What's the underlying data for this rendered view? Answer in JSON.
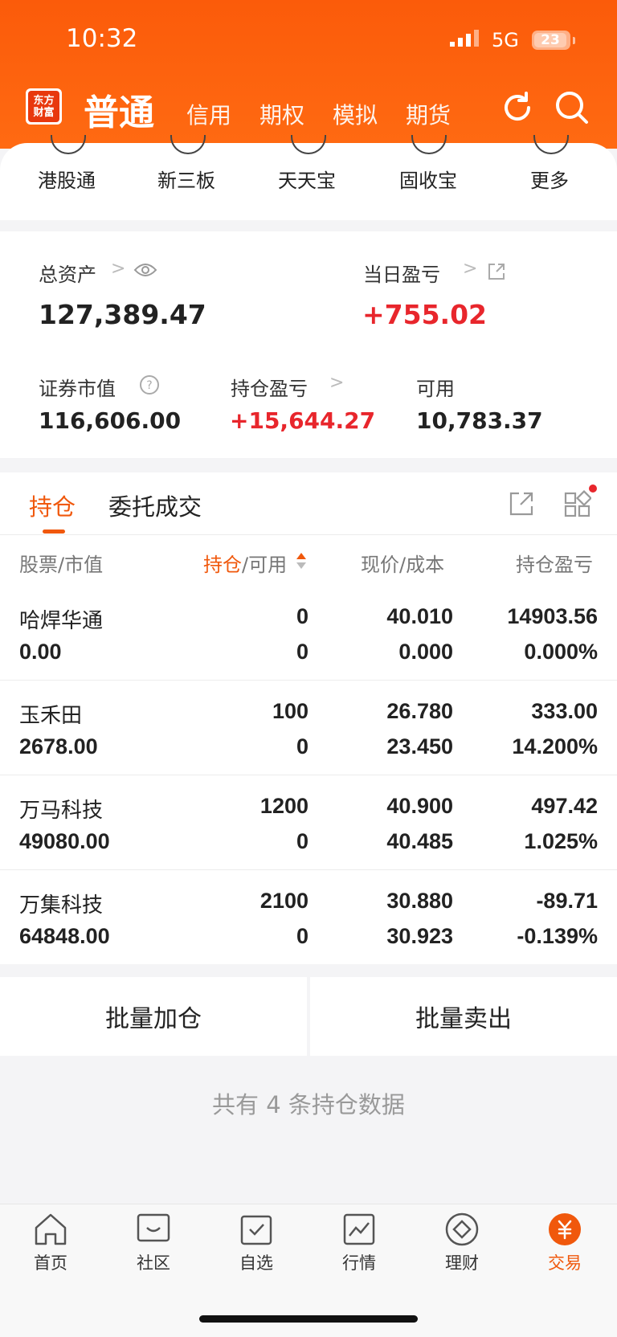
{
  "status_bar": {
    "time": "10:32",
    "network": "5G",
    "battery": "23"
  },
  "header": {
    "logo_line1": "东方",
    "logo_line2": "财富",
    "active_tab": "普通",
    "tabs": [
      "信用",
      "期权",
      "模拟",
      "期货"
    ]
  },
  "quick_menu": [
    "港股通",
    "新三板",
    "天天宝",
    "固收宝",
    "更多"
  ],
  "assets": {
    "total_label": "总资产",
    "total_value": "127,389.47",
    "daily_pl_label": "当日盈亏",
    "daily_pl_value": "+755.02",
    "market_value_label": "证券市值",
    "market_value": "116,606.00",
    "position_pl_label": "持仓盈亏",
    "position_pl_value": "+15,644.27",
    "available_label": "可用",
    "available_value": "10,783.37"
  },
  "positions": {
    "tab_active": "持仓",
    "tab_other": "委托成交",
    "headers": {
      "stock": "股票",
      "market_value": "市值",
      "hold": "持仓",
      "available": "可用",
      "price": "现价",
      "cost": "成本",
      "pl": "持仓盈亏"
    },
    "rows": [
      {
        "name": "哈焊华通",
        "market_value": "0.00",
        "hold": "0",
        "available": "0",
        "price": "40.010",
        "cost": "0.000",
        "pl": "14903.56",
        "pl_pct": "0.000%",
        "trend": "up"
      },
      {
        "name": "玉禾田",
        "market_value": "2678.00",
        "hold": "100",
        "available": "0",
        "price": "26.780",
        "cost": "23.450",
        "pl": "333.00",
        "pl_pct": "14.200%",
        "trend": "up"
      },
      {
        "name": "万马科技",
        "market_value": "49080.00",
        "hold": "1200",
        "available": "0",
        "price": "40.900",
        "cost": "40.485",
        "pl": "497.42",
        "pl_pct": "1.025%",
        "trend": "up"
      },
      {
        "name": "万集科技",
        "market_value": "64848.00",
        "hold": "2100",
        "available": "0",
        "price": "30.880",
        "cost": "30.923",
        "pl": "-89.71",
        "pl_pct": "-0.139%",
        "trend": "down"
      }
    ]
  },
  "batch": {
    "add": "批量加仓",
    "sell": "批量卖出"
  },
  "summary": "共有 4 条持仓数据",
  "bottom_nav": [
    {
      "label": "首页",
      "icon": "home-icon"
    },
    {
      "label": "社区",
      "icon": "community-icon"
    },
    {
      "label": "自选",
      "icon": "watchlist-icon"
    },
    {
      "label": "行情",
      "icon": "market-icon"
    },
    {
      "label": "理财",
      "icon": "wealth-icon"
    },
    {
      "label": "交易",
      "icon": "trade-icon"
    }
  ],
  "colors": {
    "brand": "#f0580c",
    "up": "#e8262c",
    "down": "#1a9b2d"
  }
}
